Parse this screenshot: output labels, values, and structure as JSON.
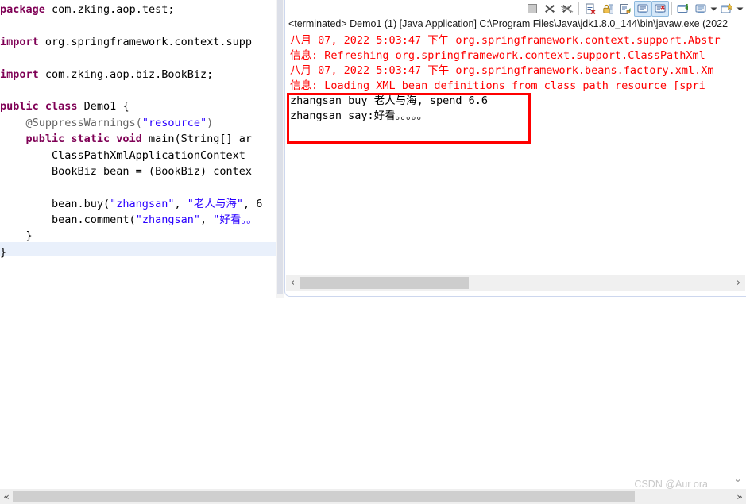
{
  "editor": {
    "name": "java-source-editor",
    "lines": [
      [
        {
          "t": "package ",
          "c": "kw"
        },
        {
          "t": "com.zking.aop.test;",
          "c": "pl"
        }
      ],
      [],
      [
        {
          "t": "import ",
          "c": "kw"
        },
        {
          "t": "org.springframework.context.supp",
          "c": "pl"
        }
      ],
      [],
      [
        {
          "t": "import ",
          "c": "kw"
        },
        {
          "t": "com.zking.aop.biz.BookBiz;",
          "c": "pl"
        }
      ],
      [],
      [
        {
          "t": "public class ",
          "c": "kw"
        },
        {
          "t": "Demo1 {",
          "c": "pl"
        }
      ],
      [
        {
          "t": "    ",
          "c": "pl"
        },
        {
          "t": "@SuppressWarnings(",
          "c": "ann"
        },
        {
          "t": "\"resource\"",
          "c": "str"
        },
        {
          "t": ")",
          "c": "ann"
        }
      ],
      [
        {
          "t": "    ",
          "c": "pl"
        },
        {
          "t": "public static void ",
          "c": "kw"
        },
        {
          "t": "main(String[] ar",
          "c": "pl"
        }
      ],
      [
        {
          "t": "        ClassPathXmlApplicationContext ",
          "c": "pl"
        }
      ],
      [
        {
          "t": "        BookBiz bean = (BookBiz) contex",
          "c": "pl"
        }
      ],
      [],
      [
        {
          "t": "        bean.buy(",
          "c": "pl"
        },
        {
          "t": "\"zhangsan\"",
          "c": "str"
        },
        {
          "t": ", ",
          "c": "pl"
        },
        {
          "t": "\"老人与海\"",
          "c": "str"
        },
        {
          "t": ", 6",
          "c": "pl"
        }
      ],
      [
        {
          "t": "        bean.comment(",
          "c": "pl"
        },
        {
          "t": "\"zhangsan\"",
          "c": "str"
        },
        {
          "t": ", ",
          "c": "pl"
        },
        {
          "t": "\"好看。。",
          "c": "str"
        }
      ],
      [
        {
          "t": "    }",
          "c": "pl"
        }
      ],
      [
        {
          "t": "}",
          "c": "pl"
        }
      ]
    ]
  },
  "console": {
    "name": "eclipse-console-view",
    "title": "<terminated> Demo1 (1) [Java Application] C:\\Program Files\\Java\\jdk1.8.0_144\\bin\\javaw.exe (2022",
    "toolbar": [
      {
        "name": "terminate-button",
        "icon": "stop-square-icon",
        "selected": false,
        "enabled": false
      },
      {
        "name": "remove-launch-button",
        "icon": "x-icon",
        "selected": false,
        "enabled": true
      },
      {
        "name": "remove-all-terminated-button",
        "icon": "x-multiple-icon",
        "selected": false,
        "enabled": true
      },
      {
        "name": "separator-1",
        "icon": "separator",
        "selected": false,
        "enabled": false
      },
      {
        "name": "clear-console-button",
        "icon": "clear-console-icon",
        "selected": false,
        "enabled": true
      },
      {
        "name": "scroll-lock-button",
        "icon": "lock-icon",
        "selected": false,
        "enabled": true
      },
      {
        "name": "word-wrap-button",
        "icon": "word-wrap-icon",
        "selected": false,
        "enabled": true
      },
      {
        "name": "show-console-on-output-button",
        "icon": "console-output-icon",
        "selected": true,
        "enabled": true
      },
      {
        "name": "show-console-on-error-button",
        "icon": "console-error-icon",
        "selected": true,
        "enabled": true
      },
      {
        "name": "separator-2",
        "icon": "separator",
        "selected": false,
        "enabled": false
      },
      {
        "name": "pin-console-button",
        "icon": "pin-console-icon",
        "selected": false,
        "enabled": true
      },
      {
        "name": "display-selected-console-button",
        "icon": "display-console-icon",
        "selected": false,
        "enabled": true
      },
      {
        "name": "display-dropdown-caret",
        "icon": "chevron-down-icon",
        "selected": false,
        "enabled": true
      },
      {
        "name": "open-console-button",
        "icon": "new-console-icon",
        "selected": false,
        "enabled": true
      },
      {
        "name": "open-console-dropdown-caret",
        "icon": "chevron-down-icon",
        "selected": false,
        "enabled": true
      }
    ],
    "output_lines": [
      {
        "text": "八月 07, 2022 5:03:47 下午 org.springframework.context.support.Abstr",
        "color": "red"
      },
      {
        "text": "信息: Refreshing org.springframework.context.support.ClassPathXml",
        "color": "red"
      },
      {
        "text": "八月 07, 2022 5:03:47 下午 org.springframework.beans.factory.xml.Xm",
        "color": "red"
      },
      {
        "text": "信息: Loading XML bean definitions from class path resource [spri",
        "color": "red"
      },
      {
        "text": "zhangsan buy 老人与海, spend 6.6",
        "color": "black"
      },
      {
        "text": "zhangsan say:好看。。。。。",
        "color": "black"
      }
    ],
    "scrollbar": {
      "left_arrow": "‹",
      "right_arrow": "›"
    }
  },
  "annotation": {
    "name": "red-highlight-rectangle",
    "color": "#ff0000"
  },
  "page": {
    "scrollbar": {
      "left_arrow": "«",
      "right_arrow": "»",
      "down_arrow": "⌄"
    },
    "watermark": "CSDN @Aur ora"
  }
}
